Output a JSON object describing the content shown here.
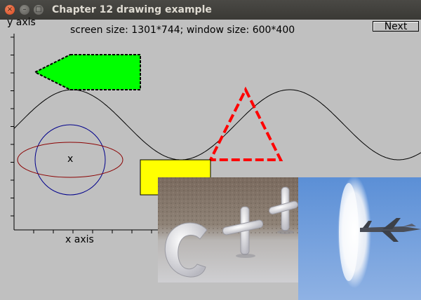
{
  "window": {
    "title": "Chapter 12 drawing example",
    "close_glyph": "×",
    "minimize_glyph": "–",
    "maximize_glyph": "□"
  },
  "header": {
    "size_text": "screen size: 1301*744; window size: 600*400"
  },
  "toolbar": {
    "next_label": "Next"
  },
  "axes": {
    "y_label": "y axis",
    "x_label": "x axis"
  },
  "mark": {
    "text": "x"
  },
  "colors": {
    "background": "#c0c0c0",
    "polygon_fill": "#00ff00",
    "rectangle_fill": "#ffff00",
    "triangle_stroke": "#ff0000",
    "circle_stroke": "#00008b",
    "ellipse_stroke": "#8b0000",
    "sine_stroke": "#000000"
  },
  "images": [
    {
      "name": "snow-sculpture-image",
      "subject": "C++ letters sculpted in snow"
    },
    {
      "name": "jet-sonic-boom-image",
      "subject": "fighter jet breaking the sound barrier"
    }
  ]
}
